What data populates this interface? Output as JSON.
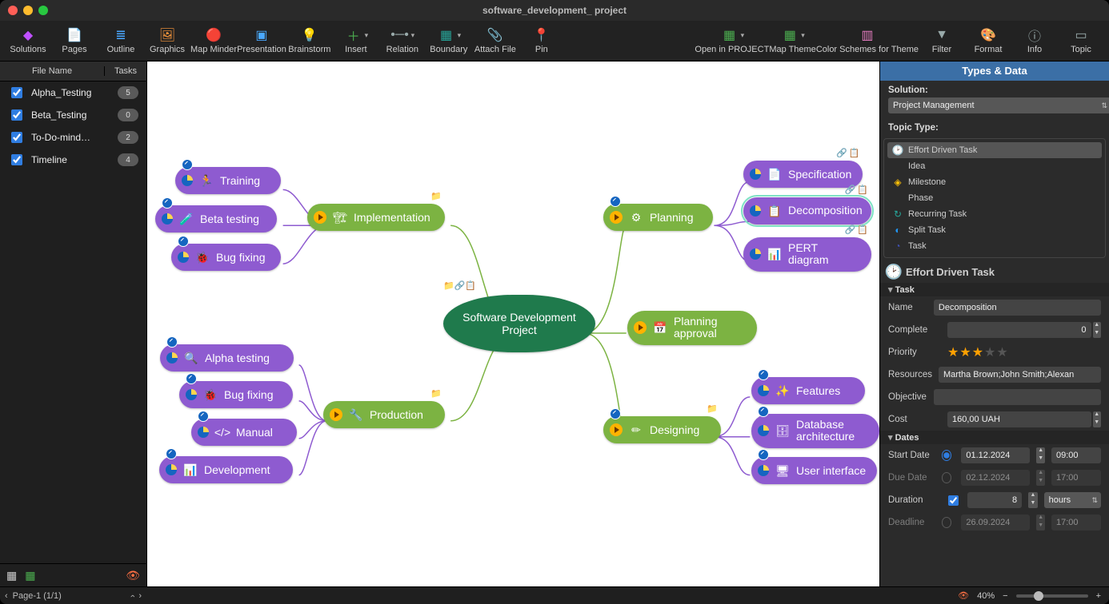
{
  "title": "software_development_ project",
  "toolbar": [
    {
      "icon": "◆",
      "label": "Solutions",
      "color": "#c050ff",
      "drop": false
    },
    {
      "icon": "📄",
      "label": "Pages",
      "color": "#4aa8ff",
      "drop": false
    },
    {
      "icon": "≣",
      "label": "Outline",
      "color": "#4aa8ff",
      "drop": false
    },
    {
      "icon": "🖼",
      "label": "Graphics",
      "color": "#ff9a3c",
      "drop": false
    },
    {
      "icon": "🔴",
      "label": "Map Minder",
      "color": "#ff5a3c",
      "drop": false
    },
    {
      "icon": "▣",
      "label": "Presentation",
      "color": "#4aa8ff",
      "drop": false
    },
    {
      "icon": "💡",
      "label": "Brainstorm",
      "color": "#8bc34a",
      "drop": false
    },
    {
      "icon": "＋",
      "label": "Insert",
      "color": "#4caf50",
      "drop": true
    },
    {
      "icon": "•─•",
      "label": "Relation",
      "color": "#9aa",
      "drop": true
    },
    {
      "icon": "▦",
      "label": "Boundary",
      "color": "#26a69a",
      "drop": true
    },
    {
      "icon": "📎",
      "label": "Attach File",
      "color": "#9aa",
      "drop": false
    },
    {
      "icon": "📍",
      "label": "Pin",
      "color": "#ef5350",
      "drop": false
    },
    {
      "spacer": true
    },
    {
      "icon": "▦",
      "label": "Open in PROJECT",
      "color": "#4caf50",
      "drop": true
    },
    {
      "icon": "▦",
      "label": "Map Theme",
      "color": "#4caf50",
      "drop": true
    },
    {
      "icon": "▥",
      "label": "Color Schemes for Theme",
      "color": "#e57cc0",
      "drop": false
    },
    {
      "icon": "▼",
      "label": "Filter",
      "color": "#9aa",
      "drop": false
    },
    {
      "icon": "🎨",
      "label": "Format",
      "color": "#9aa",
      "drop": false
    },
    {
      "icon": "ⓘ",
      "label": "Info",
      "color": "#9aa",
      "drop": false
    },
    {
      "icon": "▭",
      "label": "Topic",
      "color": "#9aa",
      "drop": false
    }
  ],
  "left": {
    "headers": {
      "filename": "File Name",
      "tasks": "Tasks"
    },
    "files": [
      {
        "name": "Alpha_Testing",
        "tasks": "5",
        "checked": true
      },
      {
        "name": "Beta_Testing",
        "tasks": "0",
        "checked": true
      },
      {
        "name": "To-Do-mind…",
        "tasks": "2",
        "checked": true
      },
      {
        "name": "Timeline",
        "tasks": "4",
        "checked": true
      }
    ],
    "pager": "Page-1 (1/1)"
  },
  "mindmap": {
    "center": "Software Development Project",
    "nodes": {
      "impl": "Implementation",
      "training": "Training",
      "betatest": "Beta testing",
      "bugfix1": "Bug fixing",
      "production": "Production",
      "alphatest": "Alpha testing",
      "bugfix2": "Bug fixing",
      "manual": "Manual",
      "development": "Development",
      "planning": "Planning",
      "spec": "Specification",
      "decomp": "Decomposition",
      "pert": "PERT diagram",
      "planapproval": "Planning approval",
      "designing": "Designing",
      "features": "Features",
      "dbarch": "Database architecture",
      "ui": "User interface"
    }
  },
  "right": {
    "header": "Types & Data",
    "solution_label": "Solution:",
    "solution_value": "Project Management",
    "topic_type_label": "Topic Type:",
    "topic_types": [
      {
        "icon": "🕑",
        "label": "Effort Driven Task",
        "sel": true
      },
      {
        "icon": "",
        "label": "Idea"
      },
      {
        "icon": "◈",
        "label": "Milestone",
        "color": "#ffc107"
      },
      {
        "icon": "",
        "label": "Phase"
      },
      {
        "icon": "↻",
        "label": "Recurring Task",
        "color": "#26a69a"
      },
      {
        "icon": "◐",
        "label": "Split Task",
        "color": "#2196f3"
      },
      {
        "icon": "◔",
        "label": "Task",
        "color": "#3f51b5"
      }
    ],
    "type_title": "Effort Driven Task",
    "groups": {
      "task": "Task",
      "dates": "Dates"
    },
    "fields": {
      "name": {
        "label": "Name",
        "value": "Decomposition"
      },
      "complete": {
        "label": "Complete",
        "value": "0"
      },
      "priority": {
        "label": "Priority",
        "stars": 3,
        "total": 5
      },
      "resources": {
        "label": "Resources",
        "value": "Martha Brown;John Smith;Alexan"
      },
      "objective": {
        "label": "Objective",
        "value": ""
      },
      "cost": {
        "label": "Cost",
        "value": "160,00 UAH"
      },
      "start": {
        "label": "Start Date",
        "date": "01.12.2024",
        "time": "09:00",
        "active": true
      },
      "due": {
        "label": "Due Date",
        "date": "02.12.2024",
        "time": "17:00",
        "active": false
      },
      "duration": {
        "label": "Duration",
        "value": "8",
        "unit": "hours",
        "checked": true
      },
      "deadline": {
        "label": "Deadline",
        "date": "26.09.2024",
        "time": "17:00",
        "active": false
      }
    }
  },
  "status": {
    "zoom": "40%"
  }
}
